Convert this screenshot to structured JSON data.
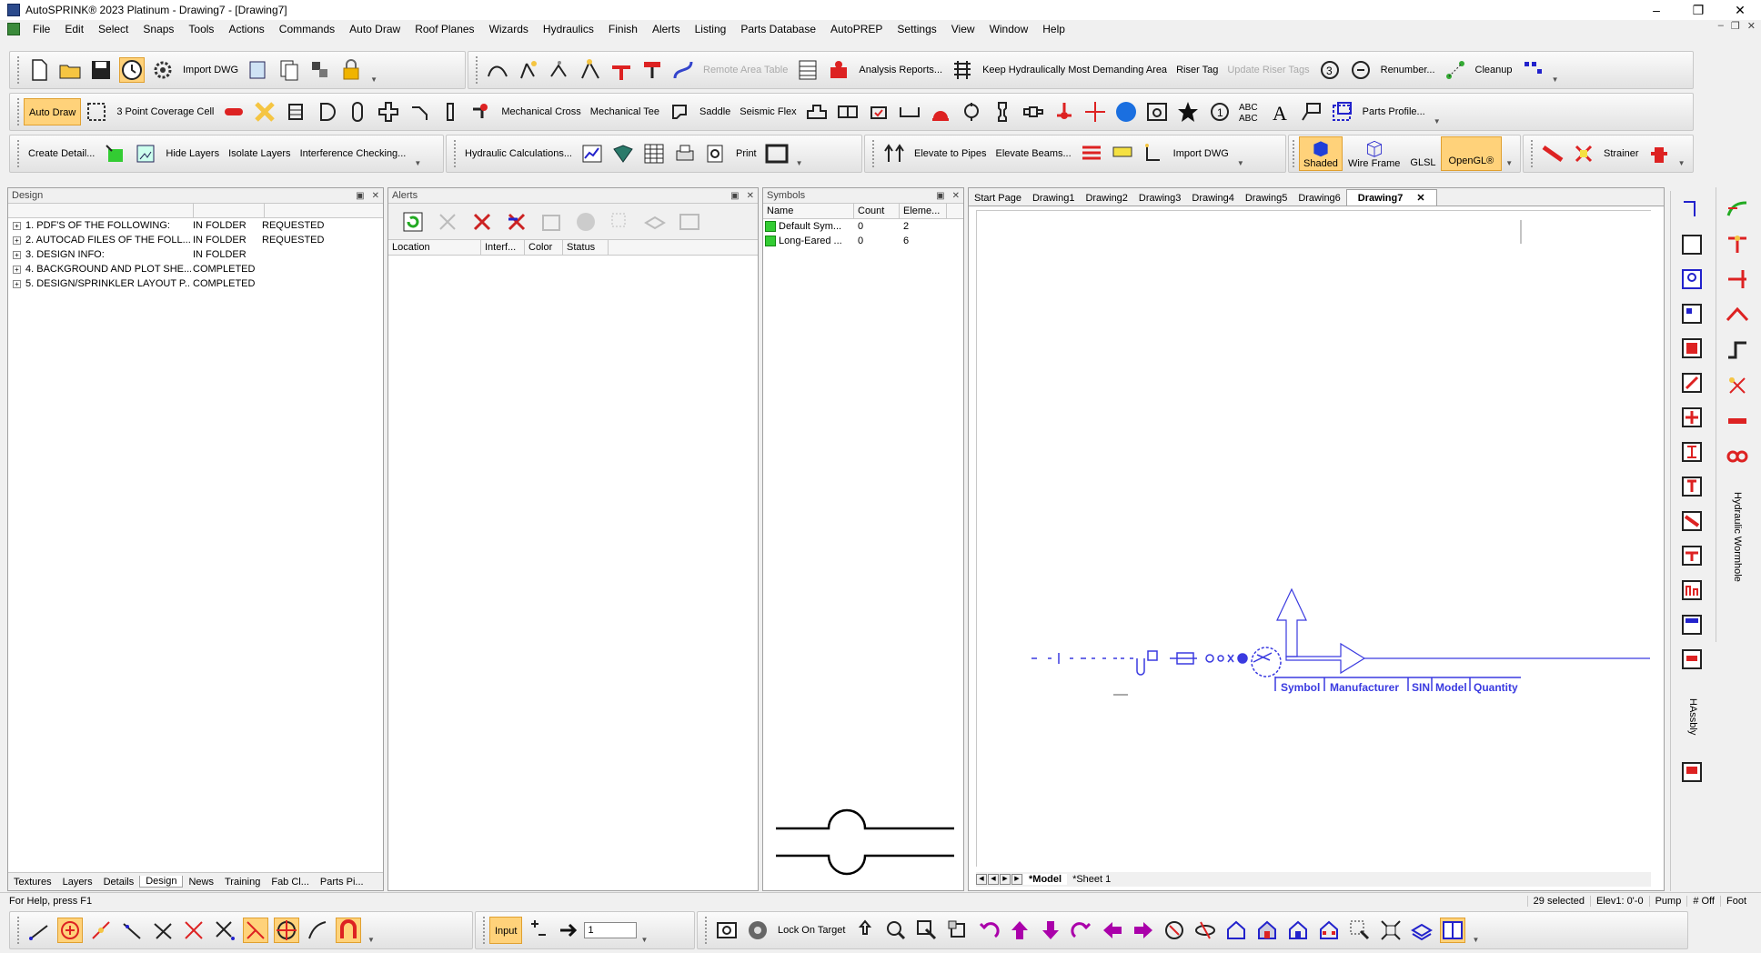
{
  "window": {
    "title": "AutoSPRINK® 2023 Platinum - Drawing7 - [Drawing7]"
  },
  "menu": [
    "File",
    "Edit",
    "Select",
    "Snaps",
    "Tools",
    "Actions",
    "Commands",
    "Auto Draw",
    "Roof Planes",
    "Wizards",
    "Hydraulics",
    "Finish",
    "Alerts",
    "Listing",
    "Parts Database",
    "AutoPREP",
    "Settings",
    "View",
    "Window",
    "Help"
  ],
  "toolbar1": {
    "import_dwg": "Import DWG",
    "remote_area_table": "Remote Area Table",
    "analysis_reports": "Analysis Reports...",
    "keep_hydraulic": "Keep Hydraulically Most Demanding Area",
    "riser_tag": "Riser Tag",
    "update_riser_tags": "Update Riser Tags",
    "renumber": "Renumber...",
    "cleanup": "Cleanup"
  },
  "toolbar2": {
    "auto_draw": "Auto Draw",
    "three_point": "3 Point Coverage Cell",
    "mech_cross": "Mechanical Cross",
    "mech_tee": "Mechanical Tee",
    "saddle": "Saddle",
    "seismic_flex": "Seismic Flex",
    "parts_profile": "Parts Profile..."
  },
  "toolbar3": {
    "create_detail": "Create Detail...",
    "hide_layers": "Hide Layers",
    "isolate_layers": "Isolate Layers",
    "interference": "Interference Checking...",
    "hydraulic_calc": "Hydraulic Calculations...",
    "print": "Print",
    "elevate_pipes": "Elevate to Pipes",
    "elevate_beams": "Elevate Beams...",
    "import_dwg": "Import DWG",
    "shaded": "Shaded",
    "wire_frame": "Wire Frame",
    "glsl": "GLSL",
    "opengl": "OpenGL®",
    "strainer": "Strainer"
  },
  "design_panel": {
    "title": "Design",
    "rows": [
      {
        "name": "1. PDF'S OF THE FOLLOWING:",
        "loc": "IN FOLDER",
        "status": "REQUESTED"
      },
      {
        "name": "2. AUTOCAD FILES OF THE FOLL...",
        "loc": "IN FOLDER",
        "status": "REQUESTED"
      },
      {
        "name": "3. DESIGN INFO:",
        "loc": "IN FOLDER",
        "status": ""
      },
      {
        "name": "4. BACKGROUND AND PLOT SHE...",
        "loc": "COMPLETED",
        "status": ""
      },
      {
        "name": "5. DESIGN/SPRINKLER LAYOUT P...",
        "loc": "COMPLETED",
        "status": ""
      }
    ],
    "tabs": [
      "Textures",
      "Layers",
      "Details",
      "Design",
      "News",
      "Training",
      "Fab Cl...",
      "Parts Pi..."
    ]
  },
  "alerts_panel": {
    "title": "Alerts",
    "columns": [
      "Location",
      "Interf...",
      "Color",
      "Status"
    ]
  },
  "symbols_panel": {
    "title": "Symbols",
    "columns": [
      "Name",
      "Count",
      "Eleme..."
    ],
    "rows": [
      {
        "name": "Default Sym...",
        "count": "0",
        "elements": "2"
      },
      {
        "name": "Long-Eared ...",
        "count": "0",
        "elements": "6"
      }
    ]
  },
  "drawing_tabs": [
    "Start Page",
    "Drawing1",
    "Drawing2",
    "Drawing3",
    "Drawing4",
    "Drawing5",
    "Drawing6",
    "Drawing7"
  ],
  "sheet_tabs": [
    "*Model",
    "*Sheet 1"
  ],
  "table_header_fragment": [
    "Symbol",
    "Manufacturer",
    "SIN",
    "Model",
    "Quantity"
  ],
  "side_labels": {
    "hydraulic_wormhole": "Hydraulic Wormhole",
    "hassbly": "HAssbly"
  },
  "status": {
    "help": "For Help, press F1",
    "selected": "29 selected",
    "elev": "Elev1: 0'-0",
    "pump": "Pump",
    "off": "# Off",
    "foot": "Foot"
  },
  "bottom_toolbar": {
    "input": "Input",
    "input_value": "1",
    "lock_on_target": "Lock On Target"
  },
  "colors": {
    "accent": "#ffd27a",
    "drawing_blue": "#3a3ae0"
  }
}
